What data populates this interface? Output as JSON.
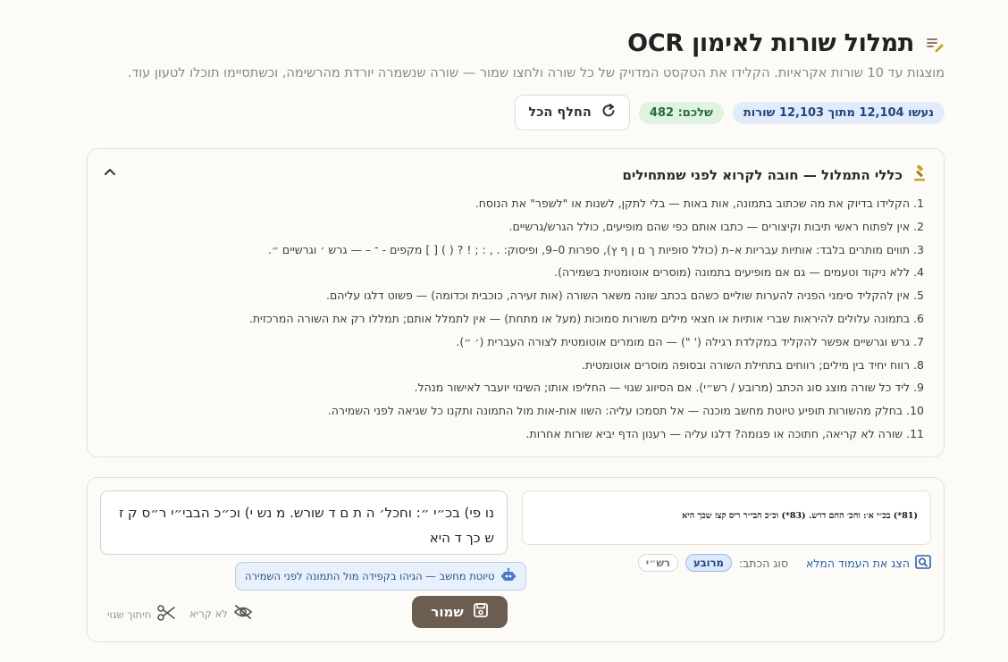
{
  "header": {
    "title": "תמלול שורות לאימון OCR",
    "subtitle": "מוצגות עד 10 שורות אקראיות. הקלידו את הטקסט המדויק של כל שורה ולחצו שמור — שורה שנשמרה יורדת מהרשימה, וכשתסיימו תוכלו לטעון עוד.",
    "progress_badge": "נעשו 12,104 מתוך 12,103 שורות",
    "yours_badge": "שלכם: 482",
    "replace_all": "החלף הכל"
  },
  "rules": {
    "title": "כללי התמלול — חובה לקרוא לפני שמתחילים",
    "items": [
      "1. הקלידו בדיוק את מה שכתוב בתמונה, אות באות — בלי לתקן, לשנות או \"לשפר\" את הנוסח.",
      "2. אין לפתוח ראשי תיבות וקיצורים — כתבו אותם כפי שהם מופיעים, כולל הגרש/גרשיים.",
      "3. תווים מותרים בלבד: אותיות עבריות א–ת (כולל סופיות ך ם ן ף ץ), ספרות 0–9, ופיסוק: . , : ; ! ? ( ) [ ] מקפים - ־ – — גרש ׳ וגרשיים ״.",
      "4. ללא ניקוד וטעמים — גם אם מופיעים בתמונה (מוסרים אוטומטית בשמירה).",
      "5. אין להקליד סימני הפניה להערות שוליים כשהם בכתב שונה משאר השורה (אות זעירה, כוכבית וכדומה) — פשוט דלגו עליהם.",
      "6. בתמונה עלולים להיראות שברי אותיות או חצאי מילים משורות סמוכות (מעל או מתחת) — אין לתמלל אותם; תמללו רק את השורה המרכזית.",
      "7. גרש וגרשיים אפשר להקליד במקלדת רגילה (' \") — הם מומרים אוטומטית לצורה העברית (׳ ״).",
      "8. רווח יחיד בין מילים; רווחים בתחילת השורה ובסופה מוסרים אוטומטית.",
      "9. ליד כל שורה מוצג סוג הכתב (מרובע / רש״י). אם הסיווג שגוי — החליפו אותו; השינוי יועבר לאישור מנהל.",
      "10. בחלק מהשורות תופיע טיוטת מחשב מוכנה — אל תסמכו עליה: השוו אות-אות מול התמונה ותקנו כל שגיאה לפני השמירה.",
      "11. שורה לא קריאה, חתוכה או פגומה? דלגו עליה — רענון הדף יביא שורות אחרות."
    ]
  },
  "line": {
    "scan_text": "(81*) בכ״י א׳: וחכ׳ החם דרש.  (83*) וכ״כ הבי״ר ריס קצז שכך היא",
    "show_page": "הצג את העמוד המלא",
    "script_label": "סוג הכתב:",
    "script_square": "מרובע",
    "script_rashi": "רש״י",
    "transcription": "נו פי) בכ״י ״: וחכל׳ ה ת ם ד שורש. מ נש י) וכ״כ הבבי״י ר״ס ק ז ש כך ד היא",
    "draft_notice": "טיוטת מחשב — הגיהו בקפידה מול התמונה לפני השמירה",
    "save": "שמור",
    "unreadable": "לא קריא",
    "bad_cut": "חיתוך שגוי"
  },
  "colors": {
    "accent_brown": "#6b5d4f",
    "badge_blue": "#e1ebfa",
    "badge_green": "#dff3e3",
    "link_blue": "#2d5fa8",
    "gavel_gold": "#c9a227"
  }
}
